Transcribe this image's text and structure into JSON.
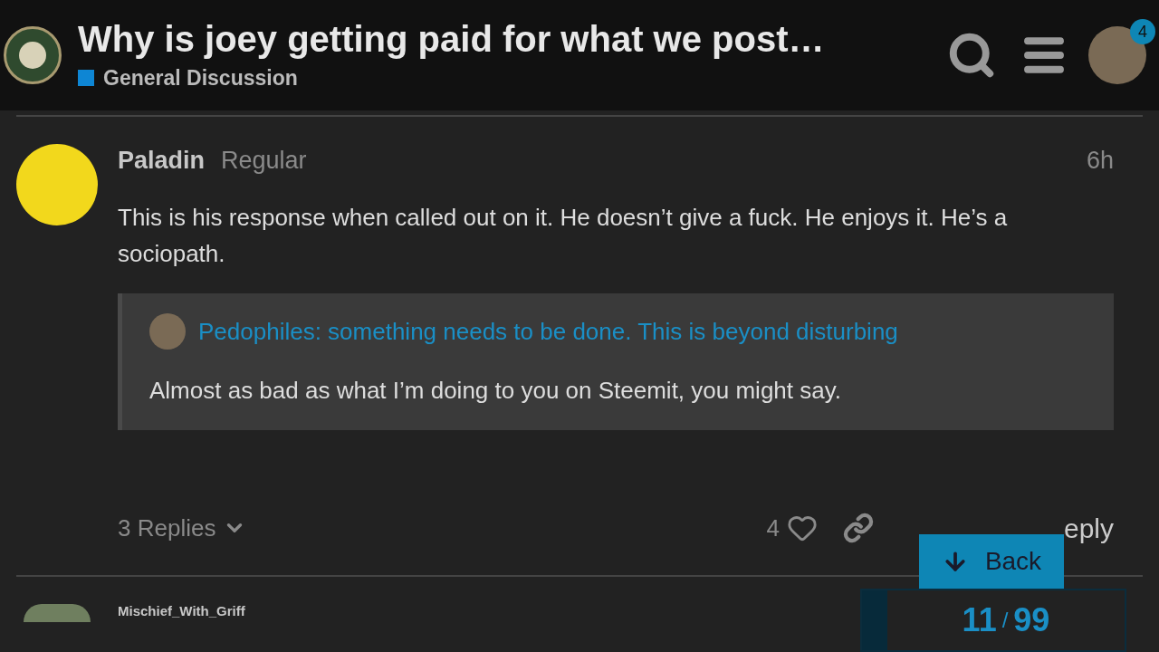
{
  "header": {
    "title": "Why is joey getting paid for what we post…",
    "category": {
      "name": "General Discussion",
      "color": "#0e86d4"
    },
    "notification_count": "4"
  },
  "post": {
    "author": "Paladin",
    "user_title": "Regular",
    "time": "6h",
    "body": "This is his response when called out on it. He doesn’t give a fuck. He enjoys it. He’s a sociopath.",
    "quote": {
      "title": "Pedophiles: something needs to be done. This is beyond disturbing",
      "text": "Almost as bad as what I’m doing to you on Steemit, you might say."
    },
    "replies": "3 Replies",
    "likes": "4",
    "reply": "eply"
  },
  "back_button": "Back",
  "progress": {
    "current": "11",
    "separator": "/",
    "total": "99"
  },
  "next_post": {
    "author": "Mischief_With_Griff"
  }
}
